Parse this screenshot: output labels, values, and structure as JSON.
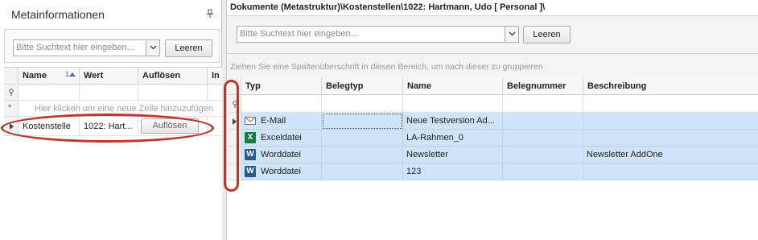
{
  "left": {
    "title": "Metainformationen",
    "search": {
      "placeholder": "Bitte Suchtext hier eingeben...",
      "clear_label": "Leeren"
    },
    "columns": [
      "Name",
      "Wert",
      "Auflösen",
      "In"
    ],
    "sort_indicator": "1",
    "new_row_hint": "Hier klicken um eine neue Zeile hinzuzufügen",
    "rows": [
      {
        "name": "Kostenstelle",
        "wert": "1022: Hart...",
        "action_label": "Auflösen"
      }
    ]
  },
  "right": {
    "title": "Dokumente (Metastruktur)\\Kostenstellen\\1022: Hartmann, Udo [ Personal ]\\",
    "search": {
      "placeholder": "Bitte Suchtext hier eingeben...",
      "clear_label": "Leeren"
    },
    "group_hint": "Ziehen Sie eine Spaltenüberschrift in diesen Bereich, um nach dieser zu gruppieren",
    "columns": [
      "Typ",
      "Belegtyp",
      "Name",
      "Belegnummer",
      "Beschreibung"
    ],
    "rows": [
      {
        "icon": "email-icon",
        "typ": "E-Mail",
        "belegtyp": "",
        "name": "Neue Testversion Ad...",
        "belegnummer": "",
        "beschreibung": ""
      },
      {
        "icon": "excel-icon",
        "typ": "Exceldatei",
        "belegtyp": "",
        "name": "LA-Rahmen_0",
        "belegnummer": "",
        "beschreibung": ""
      },
      {
        "icon": "word-icon",
        "typ": "Worddatei",
        "belegtyp": "",
        "name": "Newsletter",
        "belegnummer": "",
        "beschreibung": "Newsletter AddOne"
      },
      {
        "icon": "word-icon",
        "typ": "Worddatei",
        "belegtyp": "",
        "name": "123",
        "belegnummer": "",
        "beschreibung": ""
      }
    ]
  },
  "colors": {
    "selection": "#cfe4f7",
    "annotation_red": "#b8392a",
    "excel_green": "#1d7a3e",
    "word_blue": "#2b5797"
  }
}
